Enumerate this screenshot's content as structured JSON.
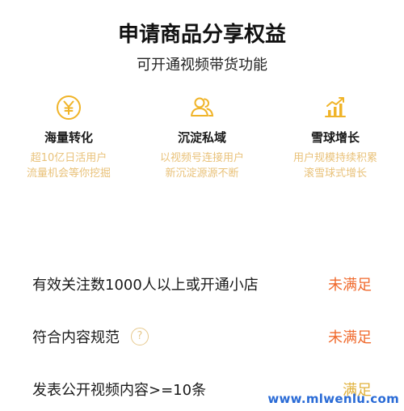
{
  "header": {
    "title": "申请商品分享权益",
    "subtitle": "可开通视频带货功能"
  },
  "benefits": [
    {
      "icon": "yen-coin-icon",
      "title": "海量转化",
      "desc_line1": "超10亿日活用户",
      "desc_line2": "流量机会等你挖掘"
    },
    {
      "icon": "users-icon",
      "title": "沉淀私域",
      "desc_line1": "以视频号连接用户",
      "desc_line2": "新沉淀源源不断"
    },
    {
      "icon": "growth-chart-icon",
      "title": "雪球增长",
      "desc_line1": "用户规模持续积累",
      "desc_line2": "滚雪球式增长"
    }
  ],
  "requirements": [
    {
      "label": "有效关注数1000人以上或开通小店",
      "status": "未满足"
    },
    {
      "label": "符合内容规范",
      "status": "未满足",
      "help": "?"
    },
    {
      "label": "发表公开视频内容>=10条",
      "status": "满足"
    }
  ],
  "watermark": "www.mlwenlu.com",
  "colors": {
    "accent": "#e9c27a",
    "unmet": "#f06a2d",
    "met": "#e0b13b"
  }
}
